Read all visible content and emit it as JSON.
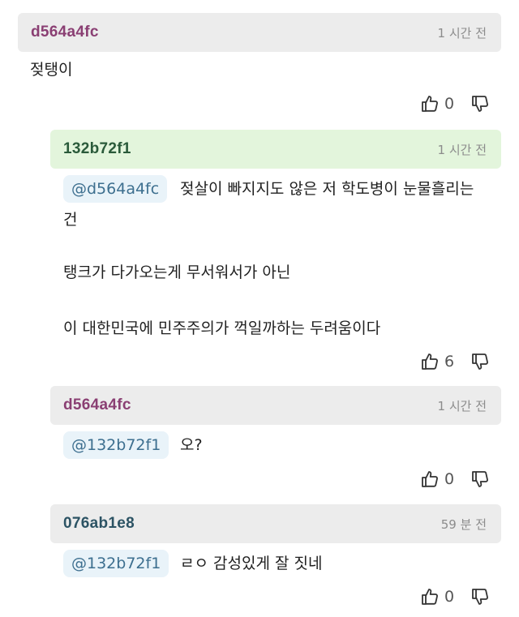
{
  "comments": [
    {
      "author": "d564a4fc",
      "time": "1 시간 전",
      "lines": [
        "젖탱이"
      ],
      "likes": "0"
    },
    {
      "author": "132b72f1",
      "time": "1 시간 전",
      "mention": "@d564a4fc",
      "first_line": "젖살이 빠지지도 않은 저 학도병이 눈물흘리는",
      "lines": [
        "건",
        "탱크가 다가오는게 무서워서가 아닌",
        "이 대한민국에 민주주의가 꺽일까하는 두려움이다"
      ],
      "likes": "6"
    },
    {
      "author": "d564a4fc",
      "time": "1 시간 전",
      "mention": "@132b72f1",
      "first_line": "오?",
      "likes": "0"
    },
    {
      "author": "076ab1e8",
      "time": "59 분 전",
      "mention": "@132b72f1",
      "first_line": "ㄹㅇ 감성있게 잘 짓네",
      "likes": "0"
    }
  ],
  "colors": {
    "header_gray": "#ececec",
    "header_green": "#e3f5dc",
    "author_purple": "#8a3f73",
    "author_green": "#2a5a3a",
    "author_teal": "#2c5364",
    "mention_bg": "#e9f3f9",
    "mention_text": "#3d6f8f"
  },
  "icons": [
    "thumbs-up-icon",
    "thumbs-down-icon"
  ]
}
